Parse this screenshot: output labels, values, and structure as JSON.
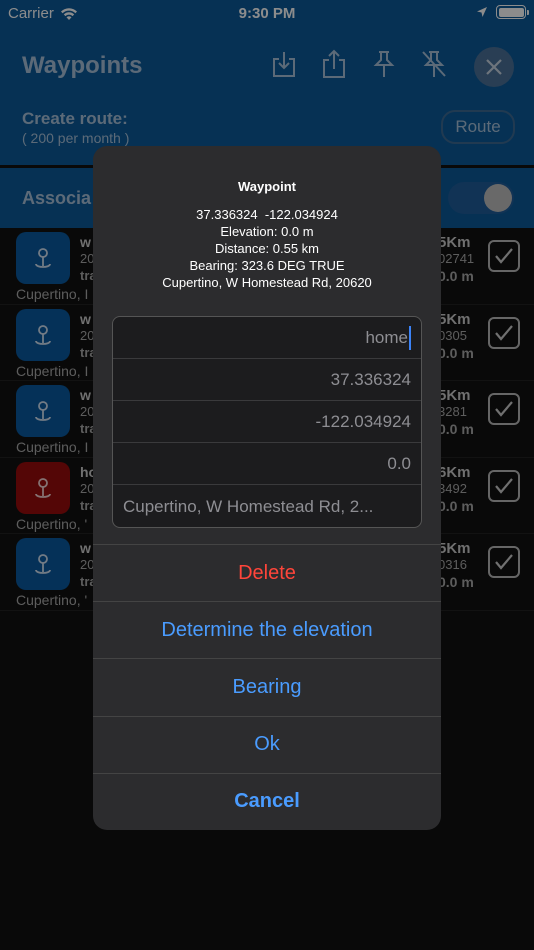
{
  "status_bar": {
    "carrier": "Carrier",
    "time": "9:30 PM"
  },
  "header": {
    "title": "Waypoints",
    "create_route_label": "Create route:",
    "per_month": "( 200 per month )",
    "route_button": "Route",
    "icons": [
      "download-icon",
      "share-icon",
      "pin-icon",
      "pin-off-icon",
      "close-icon"
    ]
  },
  "assoc": {
    "label": "Associa"
  },
  "list": [
    {
      "name": "w",
      "date": "20",
      "type": "tra",
      "addr": "Cupertino, I",
      "dist": "5Km",
      "code": "02741",
      "elev": "0.0 m",
      "color": "blue"
    },
    {
      "name": "w",
      "date": "20",
      "type": "tra",
      "addr": "Cupertino, I",
      "dist": "5Km",
      "code": "0305",
      "elev": "0.0 m",
      "color": "blue"
    },
    {
      "name": "w",
      "date": "20",
      "type": "tra",
      "addr": "Cupertino, I",
      "dist": "5Km",
      "code": "3281",
      "elev": "0.0 m",
      "color": "blue"
    },
    {
      "name": "ho",
      "date": "20",
      "type": "tra",
      "addr": "Cupertino, '",
      "dist": "6Km",
      "code": "3492",
      "elev": "0.0 m",
      "color": "red"
    },
    {
      "name": "w",
      "date": "20",
      "type": "tra",
      "addr": "Cupertino, '",
      "dist": "5Km",
      "code": "0316",
      "elev": "0.0 m",
      "color": "blue"
    }
  ],
  "dialog": {
    "title": "Waypoint",
    "coords": "37.336324  -122.034924",
    "elevation": "Elevation: 0.0 m",
    "distance": "Distance: 0.55 km",
    "bearing": "Bearing: 323.6 DEG TRUE",
    "address": "Cupertino, W Homestead Rd, 20620",
    "fields": {
      "name": "home",
      "latitude": "37.336324",
      "longitude": "-122.034924",
      "elevation": "0.0",
      "address": "Cupertino, W Homestead Rd, 2..."
    },
    "actions": {
      "delete": "Delete",
      "determine_elevation": "Determine the elevation",
      "bearing": "Bearing",
      "ok": "Ok",
      "cancel": "Cancel"
    }
  }
}
